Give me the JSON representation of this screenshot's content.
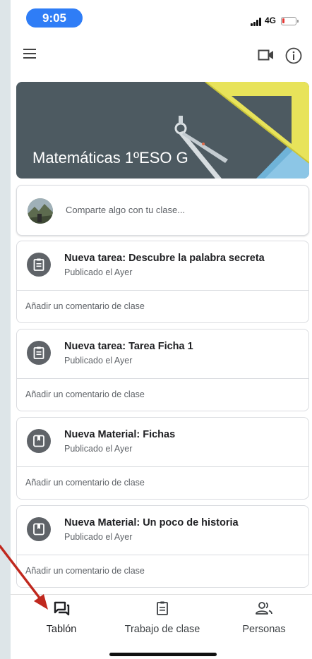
{
  "status_bar": {
    "time": "9:05",
    "network": "4G",
    "time_pill_color": "#2f7df6",
    "battery_color": "#e53935"
  },
  "top_bar": {
    "menu_icon": "hamburger-menu-icon",
    "video_icon": "video-camera-icon",
    "info_icon": "info-icon"
  },
  "banner": {
    "title": "Matemáticas 1ºESO G",
    "background": "#4d5a61"
  },
  "share": {
    "placeholder": "Comparte algo con tu clase..."
  },
  "posts": [
    {
      "icon": "assignment-icon",
      "title": "Nueva tarea: Descubre la palabra secreta",
      "meta": "Publicado el Ayer",
      "comment": "Añadir un comentario de clase"
    },
    {
      "icon": "assignment-icon",
      "title": "Nueva tarea: Tarea Ficha 1",
      "meta": "Publicado el Ayer",
      "comment": "Añadir un comentario de clase"
    },
    {
      "icon": "material-icon",
      "title": "Nueva Material: Fichas",
      "meta": "Publicado el Ayer",
      "comment": "Añadir un comentario de clase"
    },
    {
      "icon": "material-icon",
      "title": "Nueva Material: Un poco de historia",
      "meta": "Publicado el Ayer",
      "comment": "Añadir un comentario de clase"
    }
  ],
  "bottom_nav": {
    "items": [
      {
        "label": "Tablón",
        "icon": "stream-icon",
        "active": true
      },
      {
        "label": "Trabajo de clase",
        "icon": "classwork-icon",
        "active": false
      },
      {
        "label": "Personas",
        "icon": "people-icon",
        "active": false
      }
    ]
  },
  "annotation": {
    "arrow_color": "#c0281e"
  }
}
